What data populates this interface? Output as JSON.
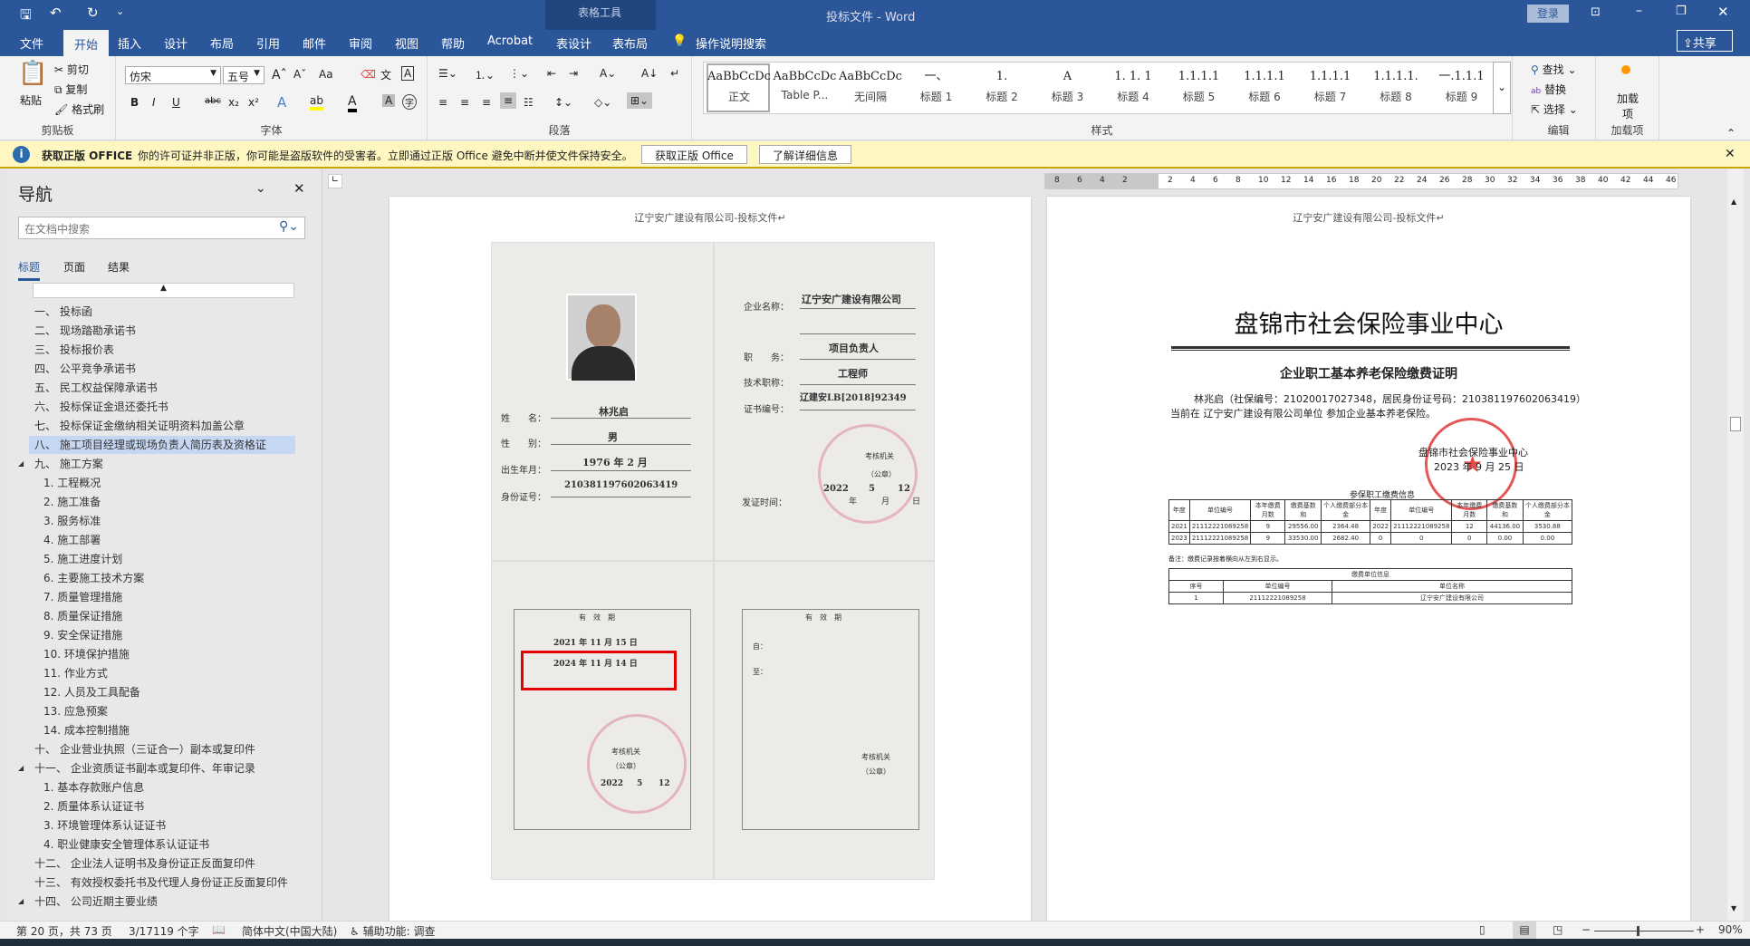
{
  "titlebar": {
    "doc_title": "投标文件",
    "sep": "-",
    "app": "Word",
    "context_tab_group": "表格工具",
    "login": "登录",
    "qat": {
      "save": "save-icon",
      "undo": "undo-icon",
      "redo": "redo-icon"
    }
  },
  "tabs": [
    {
      "label": "文件"
    },
    {
      "label": "开始",
      "active": true
    },
    {
      "label": "插入"
    },
    {
      "label": "设计"
    },
    {
      "label": "布局"
    },
    {
      "label": "引用"
    },
    {
      "label": "邮件"
    },
    {
      "label": "审阅"
    },
    {
      "label": "视图"
    },
    {
      "label": "帮助"
    },
    {
      "label": "Acrobat"
    },
    {
      "label": "表设计"
    },
    {
      "label": "表布局"
    }
  ],
  "tell_me": "操作说明搜索",
  "share": "共享",
  "ribbon": {
    "clipboard": {
      "label": "剪贴板",
      "paste": "粘贴",
      "cut": "剪切",
      "copy": "复制",
      "format_painter": "格式刷"
    },
    "font": {
      "label": "字体",
      "font_name": "仿宋",
      "font_size": "五号",
      "bold": "B",
      "italic": "I",
      "underline": "U",
      "strike": "abc",
      "sub": "x₂",
      "sup": "x²",
      "case": "Aa"
    },
    "paragraph": {
      "label": "段落"
    },
    "styles": {
      "label": "样式",
      "items": [
        {
          "preview": "AaBbCcDc",
          "name": "正文"
        },
        {
          "preview": "AaBbCcDc",
          "name": "Table P..."
        },
        {
          "preview": "AaBbCcDc",
          "name": "无间隔"
        },
        {
          "preview": "一、",
          "name": "标题 1"
        },
        {
          "preview": "1.",
          "name": "标题 2"
        },
        {
          "preview": "A",
          "name": "标题 3"
        },
        {
          "preview": "1. 1. 1",
          "name": "标题 4"
        },
        {
          "preview": "1.1.1.1",
          "name": "标题 5"
        },
        {
          "preview": "1.1.1.1",
          "name": "标题 6"
        },
        {
          "preview": "1.1.1.1",
          "name": "标题 7"
        },
        {
          "preview": "1.1.1.1.",
          "name": "标题 8"
        },
        {
          "preview": "一.1.1.1",
          "name": "标题 9"
        }
      ]
    },
    "editing": {
      "label": "编辑",
      "find": "查找",
      "replace": "替换",
      "select": "选择"
    },
    "addins": {
      "label": "加载项",
      "button": "加载项"
    }
  },
  "msgbar": {
    "title": "获取正版 OFFICE",
    "text": "你的许可证并非正版，你可能是盗版软件的受害者。立即通过正版 Office 避免中断并使文件保持安全。",
    "btn1": "获取正版 Office",
    "btn2": "了解详细信息"
  },
  "nav": {
    "title": "导航",
    "search_placeholder": "在文档中搜索",
    "tabs": [
      "标题",
      "页面",
      "结果"
    ],
    "items": [
      {
        "t": "一、 投标函",
        "l": 1
      },
      {
        "t": "二、 现场踏勘承诺书",
        "l": 1
      },
      {
        "t": "三、 投标报价表",
        "l": 1
      },
      {
        "t": "四、 公平竞争承诺书",
        "l": 1
      },
      {
        "t": "五、 民工权益保障承诺书",
        "l": 1
      },
      {
        "t": "六、 投标保证金退还委托书",
        "l": 1
      },
      {
        "t": "七、 投标保证金缴纳相关证明资料加盖公章",
        "l": 1
      },
      {
        "t": "八、 施工项目经理或现场负责人简历表及资格证",
        "l": 1,
        "sel": true
      },
      {
        "t": "九、 施工方案",
        "l": 1,
        "exp": true
      },
      {
        "t": "1. 工程概况",
        "l": 2
      },
      {
        "t": "2. 施工准备",
        "l": 2
      },
      {
        "t": "3. 服务标准",
        "l": 2
      },
      {
        "t": "4. 施工部署",
        "l": 2
      },
      {
        "t": "5. 施工进度计划",
        "l": 2
      },
      {
        "t": "6. 主要施工技术方案",
        "l": 2
      },
      {
        "t": "7. 质量管理措施",
        "l": 2
      },
      {
        "t": "8. 质量保证措施",
        "l": 2
      },
      {
        "t": "9. 安全保证措施",
        "l": 2
      },
      {
        "t": "10. 环境保护措施",
        "l": 2
      },
      {
        "t": "11. 作业方式",
        "l": 2
      },
      {
        "t": "12. 人员及工具配备",
        "l": 2
      },
      {
        "t": "13. 应急预案",
        "l": 2
      },
      {
        "t": "14. 成本控制措施",
        "l": 2
      },
      {
        "t": "十、 企业营业执照（三证合一）副本或复印件",
        "l": 1
      },
      {
        "t": "十一、 企业资质证书副本或复印件、年审记录",
        "l": 1,
        "exp": true
      },
      {
        "t": "1. 基本存款账户信息",
        "l": 2
      },
      {
        "t": "2. 质量体系认证证书",
        "l": 2
      },
      {
        "t": "3. 环境管理体系认证证书",
        "l": 2
      },
      {
        "t": "4. 职业健康安全管理体系认证证书",
        "l": 2
      },
      {
        "t": "十二、 企业法人证明书及身份证正反面复印件",
        "l": 1
      },
      {
        "t": "十三、 有效授权委托书及代理人身份证正反面复印件",
        "l": 1
      },
      {
        "t": "十四、 公司近期主要业绩",
        "l": 1,
        "exp": true
      }
    ]
  },
  "ruler": [
    "8",
    "6",
    "4",
    "2",
    "",
    "2",
    "4",
    "6",
    "8",
    "10",
    "12",
    "14",
    "16",
    "18",
    "20",
    "22",
    "24",
    "26",
    "28",
    "30",
    "32",
    "34",
    "36",
    "38",
    "40",
    "42",
    "44",
    "46"
  ],
  "page_header": "辽宁安广建设有限公司-投标文件↵",
  "cert": {
    "company_label": "企业名称：",
    "company": "辽宁安广建设有限公司",
    "duty_label": "职　　务：",
    "duty": "项目负责人",
    "title_label": "技术职称：",
    "title": "工程师",
    "certno_label": "证书编号：",
    "certno": "辽建安LB[2018]92349",
    "issue_label": "发证时间：",
    "issue_y": "2022",
    "issue_m": "5",
    "issue_d": "12",
    "y": "年",
    "m": "月",
    "d": "日",
    "authority": "考核机关",
    "seal": "（公章）",
    "name_label": "姓　　名：",
    "name": "林兆启",
    "sex_label": "性　　别：",
    "sex": "男",
    "birth_label": "出生年月：",
    "birth": "1976 年 2 月",
    "id_label": "身份证号：",
    "id": "210381197602063419",
    "validity": "有　效　期",
    "valid_from": "2021 年 11 月 15 日",
    "valid_to": "2024 年 11 月 14 日",
    "from_label": "自：",
    "to_label": "至：",
    "highlight_color": "#e00000"
  },
  "insurance": {
    "title": "盘锦市社会保险事业中心",
    "subtitle": "企业职工基本养老保险缴费证明",
    "para1": "林兆启（社保编号：21020017027348，居民身份证号码：210381197602063419）",
    "para2": "当前在 辽宁安广建设有限公司单位 参加企业基本养老保险。",
    "sign": "盘锦市社会保险事业中心",
    "date": "2023 年 9 月 25 日",
    "table_caption": "参保职工缴费信息",
    "headers": [
      "年度",
      "单位编号",
      "本年缴费月数",
      "缴费基数和",
      "个人缴费部分本金",
      "年度",
      "单位编号",
      "本年缴费月数",
      "缴费基数和",
      "个人缴费部分本金"
    ],
    "rows": [
      [
        "2021",
        "21112221089258",
        "9",
        "29556.00",
        "2364.48",
        "2022",
        "21112221089258",
        "12",
        "44136.00",
        "3530.88"
      ],
      [
        "2023",
        "21112221089258",
        "9",
        "33530.00",
        "2682.40",
        "0",
        "0",
        "0",
        "0.00",
        "0.00"
      ]
    ],
    "note": "备注：缴费记录按着横向从左到右显示。",
    "unit_caption": "缴费单位信息",
    "unit_headers": [
      "序号",
      "单位编号",
      "单位名称"
    ],
    "unit_row": [
      "1",
      "21112221089258",
      "辽宁安广建设有限公司"
    ]
  },
  "status": {
    "page": "第 20 页，共 73 页",
    "words": "3/17119 个字",
    "lang": "简体中文(中国大陆)",
    "accessibility": "辅助功能: 调查",
    "zoom": "90%"
  }
}
